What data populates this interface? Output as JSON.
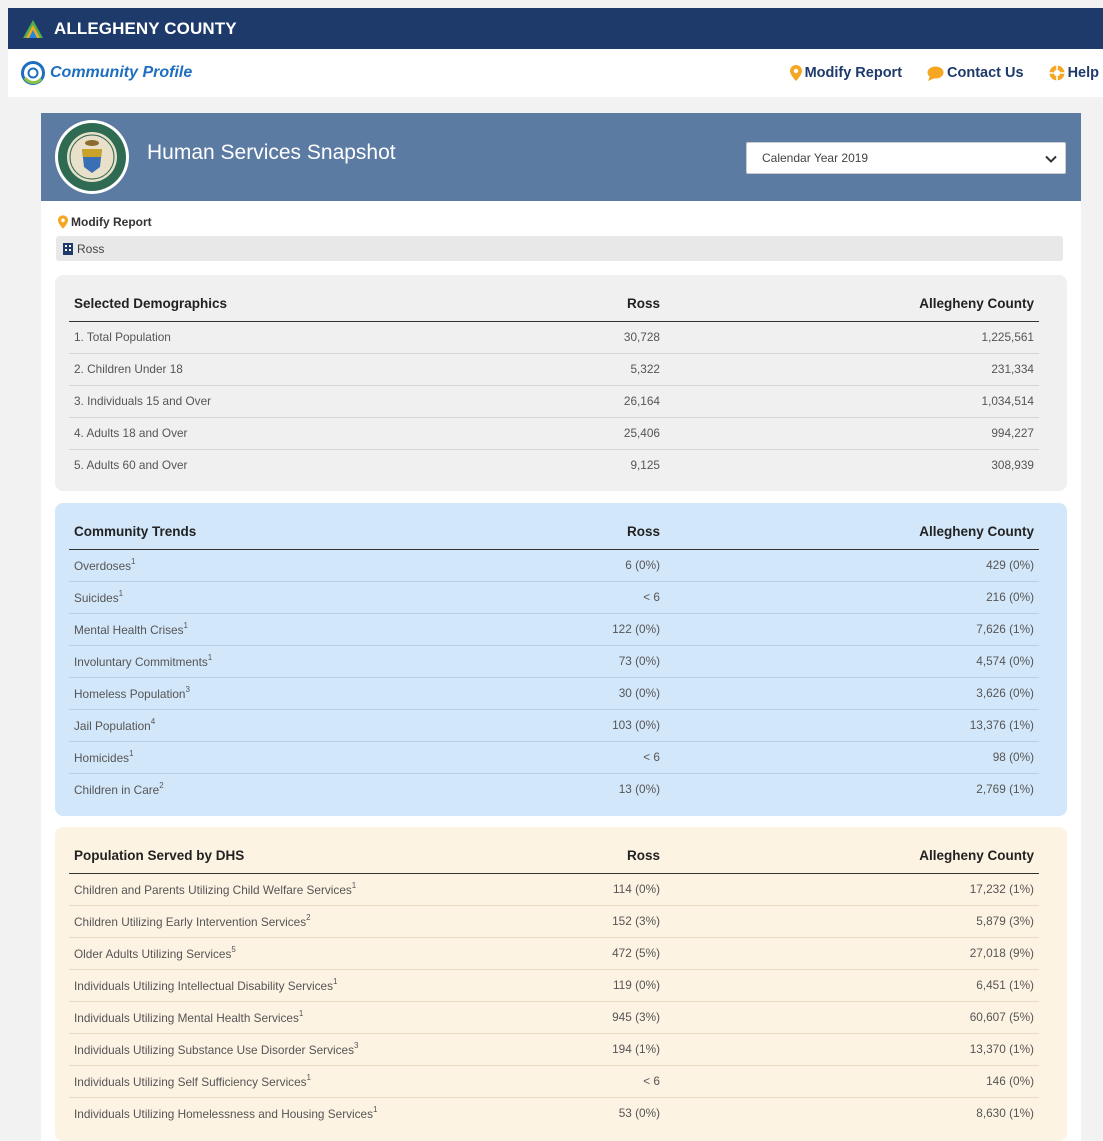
{
  "topbar": {
    "brand": "ALLEGHENY COUNTY"
  },
  "navbar": {
    "title": "Community Profile",
    "links": [
      {
        "label": "Modify Report",
        "icon": "map-pin-icon"
      },
      {
        "label": "Contact Us",
        "icon": "chat-bubble-icon"
      },
      {
        "label": "Help",
        "icon": "lifebuoy-icon"
      }
    ]
  },
  "header": {
    "title": "Human Services Snapshot",
    "year_selected": "Calendar Year 2019"
  },
  "modify_link": "Modify Report",
  "breadcrumb": "Ross",
  "colors": {
    "topbar": "#1e3a6b",
    "header": "#5c7ba3",
    "trends_bg": "#d3e7fa",
    "dhs_bg": "#fdf3e3",
    "accent_orange": "#f5a623"
  },
  "tables": {
    "demographics": {
      "headers": [
        "Selected Demographics",
        "Ross",
        "Allegheny County"
      ],
      "rows": [
        {
          "label": "1. Total Population",
          "sup": "",
          "ross": "30,728",
          "county": "1,225,561"
        },
        {
          "label": "2. Children Under 18",
          "sup": "",
          "ross": "5,322",
          "county": "231,334"
        },
        {
          "label": "3. Individuals 15 and Over",
          "sup": "",
          "ross": "26,164",
          "county": "1,034,514"
        },
        {
          "label": "4. Adults 18 and Over",
          "sup": "",
          "ross": "25,406",
          "county": "994,227"
        },
        {
          "label": "5. Adults 60 and Over",
          "sup": "",
          "ross": "9,125",
          "county": "308,939"
        }
      ]
    },
    "trends": {
      "headers": [
        "Community Trends",
        "Ross",
        "Allegheny County"
      ],
      "rows": [
        {
          "label": "Overdoses",
          "sup": "1",
          "ross": "6 (0%)",
          "county": "429 (0%)"
        },
        {
          "label": "Suicides",
          "sup": "1",
          "ross": "< 6",
          "county": "216 (0%)"
        },
        {
          "label": "Mental Health Crises",
          "sup": "1",
          "ross": "122 (0%)",
          "county": "7,626 (1%)"
        },
        {
          "label": "Involuntary Commitments",
          "sup": "1",
          "ross": "73 (0%)",
          "county": "4,574 (0%)"
        },
        {
          "label": "Homeless Population",
          "sup": "3",
          "ross": "30 (0%)",
          "county": "3,626 (0%)"
        },
        {
          "label": "Jail Population",
          "sup": "4",
          "ross": "103 (0%)",
          "county": "13,376 (1%)"
        },
        {
          "label": "Homicides",
          "sup": "1",
          "ross": "< 6",
          "county": "98 (0%)"
        },
        {
          "label": "Children in Care",
          "sup": "2",
          "ross": "13 (0%)",
          "county": "2,769 (1%)"
        }
      ]
    },
    "dhs": {
      "headers": [
        "Population Served by DHS",
        "Ross",
        "Allegheny County"
      ],
      "rows": [
        {
          "label": "Children and Parents Utilizing Child Welfare Services",
          "sup": "1",
          "ross": "114 (0%)",
          "county": "17,232 (1%)"
        },
        {
          "label": "Children Utilizing Early Intervention Services",
          "sup": "2",
          "ross": "152 (3%)",
          "county": "5,879 (3%)"
        },
        {
          "label": "Older Adults Utilizing Services",
          "sup": "5",
          "ross": "472 (5%)",
          "county": "27,018 (9%)"
        },
        {
          "label": "Individuals Utilizing Intellectual Disability Services",
          "sup": "1",
          "ross": "119 (0%)",
          "county": "6,451 (1%)"
        },
        {
          "label": "Individuals Utilizing Mental Health Services",
          "sup": "1",
          "ross": "945 (3%)",
          "county": "60,607 (5%)"
        },
        {
          "label": "Individuals Utilizing Substance Use Disorder Services",
          "sup": "3",
          "ross": "194 (1%)",
          "county": "13,370 (1%)"
        },
        {
          "label": "Individuals Utilizing Self Sufficiency Services",
          "sup": "1",
          "ross": "< 6",
          "county": "146 (0%)"
        },
        {
          "label": "Individuals Utilizing Homelessness and Housing Services",
          "sup": "1",
          "ross": "53 (0%)",
          "county": "8,630 (1%)"
        }
      ]
    }
  }
}
